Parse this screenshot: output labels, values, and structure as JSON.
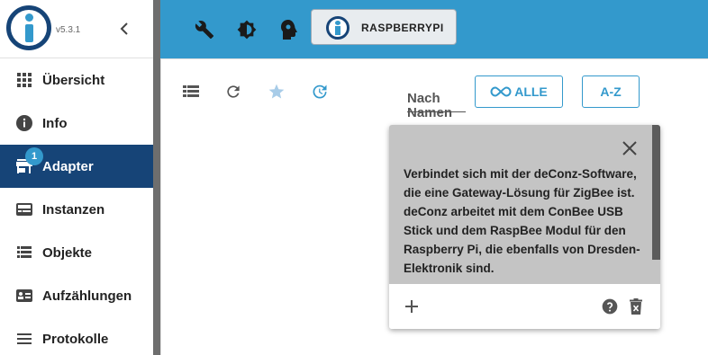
{
  "sidebar": {
    "version": "v5.3.1",
    "items": [
      {
        "label": "Übersicht",
        "icon": "apps-grid-icon"
      },
      {
        "label": "Info",
        "icon": "info-icon"
      },
      {
        "label": "Adapter",
        "icon": "store-icon",
        "badge": "1",
        "active": true
      },
      {
        "label": "Instanzen",
        "icon": "instances-icon"
      },
      {
        "label": "Objekte",
        "icon": "list-icon"
      },
      {
        "label": "Aufzählungen",
        "icon": "enum-icon"
      },
      {
        "label": "Protokolle",
        "icon": "log-icon"
      }
    ]
  },
  "topbar": {
    "host_name": "RASPBERRYPI",
    "icons": [
      "wrench-icon",
      "brightness-icon",
      "expert-mode-icon"
    ]
  },
  "toolbar": {
    "icons": [
      "list-view-icon",
      "refresh-icon",
      "star-icon",
      "update-icon"
    ],
    "filter_label": "Nach Namen filtern",
    "all_button": "ALLE",
    "az_button": "A-Z"
  },
  "card": {
    "description": "Verbindet sich mit der deConz-Software, die eine Gateway-Lösung für ZigBee ist. deConz arbeitet mit dem ConBee USB Stick und dem RaspBee Modul für den Raspberry Pi, die ebenfalls von Dresden-Elektronik sind."
  },
  "colors": {
    "primary": "#3399cc",
    "sidebar_active": "#164477",
    "card_bg": "#c4c4c4"
  }
}
